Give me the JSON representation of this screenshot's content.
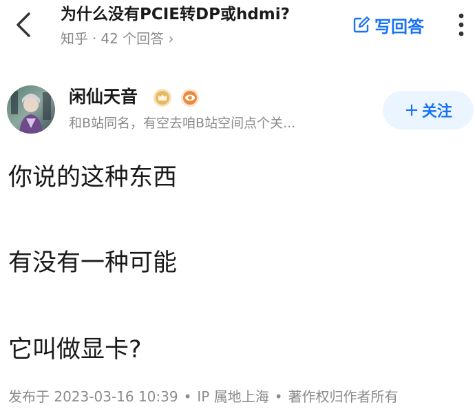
{
  "header": {
    "question_title": "为什么没有PCIE转DP或hdmi?",
    "source": "知乎",
    "separator": "·",
    "answer_count": "42 个回答",
    "chevron": "›",
    "write_answer_label": "写回答"
  },
  "author": {
    "name": "闲仙天音",
    "bio": "和B站同名，有空去咱B站空间点个关...",
    "follow_plus": "+",
    "follow_label": "关注"
  },
  "answer": {
    "paragraphs": [
      "你说的这种东西",
      "有没有一种可能",
      "它叫做显卡?"
    ]
  },
  "footer": {
    "published": "发布于 2023-03-16 10:39",
    "dot1": "•",
    "ip": "IP 属地上海",
    "dot2": "•",
    "copyright": "著作权归作者所有"
  },
  "colors": {
    "accent": "#1772f6",
    "follow_bg": "#ebf5ff",
    "muted_text": "#8a8a8a",
    "primary_text": "#1a1a1a",
    "badge_gold": "#e0a63b",
    "badge_orange": "#e8782a"
  },
  "icons": {
    "back": "chevron-left-icon",
    "write": "edit-icon",
    "more": "more-vertical-icon",
    "badge1": "crown-badge-icon",
    "badge2": "eye-badge-icon"
  }
}
